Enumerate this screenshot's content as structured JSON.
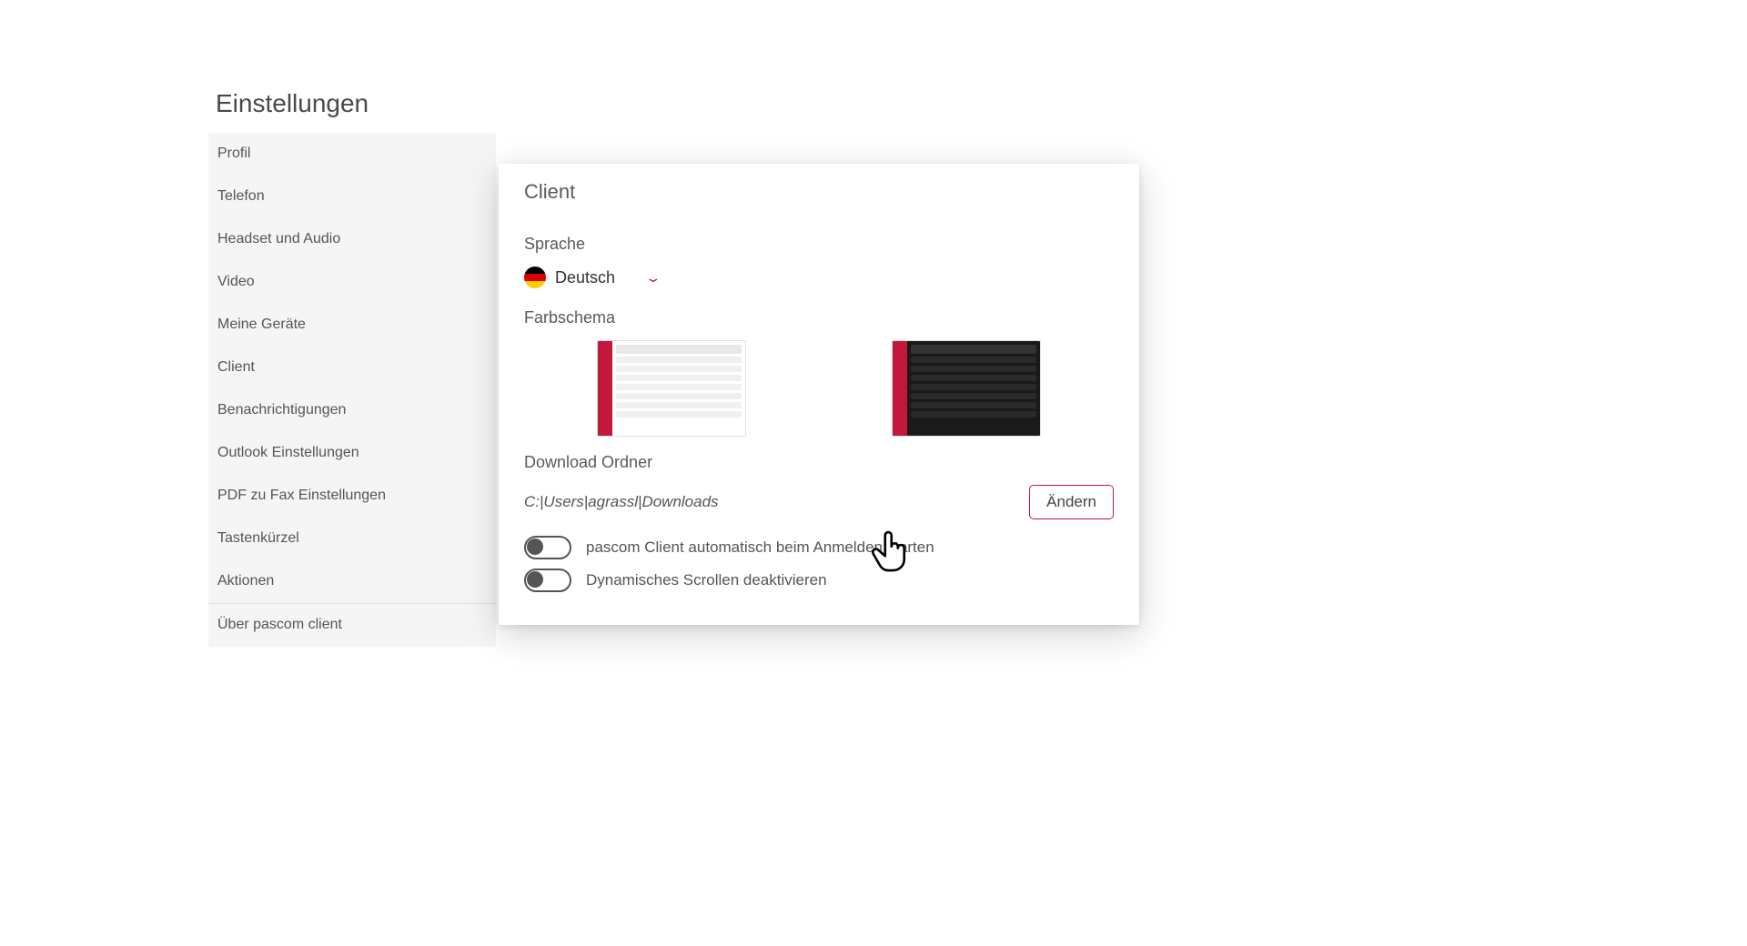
{
  "pageTitle": "Einstellungen",
  "sidebar": {
    "items": [
      "Profil",
      "Telefon",
      "Headset und Audio",
      "Video",
      "Meine Geräte",
      "Client",
      "Benachrichtigungen",
      "Outlook Einstellungen",
      "PDF zu Fax Einstellungen",
      "Tastenkürzel",
      "Aktionen",
      "Über pascom client"
    ]
  },
  "card": {
    "title": "Client",
    "language": {
      "label": "Sprache",
      "selected": "Deutsch"
    },
    "colorScheme": {
      "label": "Farbschema"
    },
    "downloadFolder": {
      "label": "Download Ordner",
      "path": "C:|Users|agrassl|Downloads",
      "changeButton": "Ändern"
    },
    "toggles": {
      "autostart": "pascom Client automatisch beim Anmelden starten",
      "disableScroll": "Dynamisches Scrollen deaktivieren"
    }
  }
}
